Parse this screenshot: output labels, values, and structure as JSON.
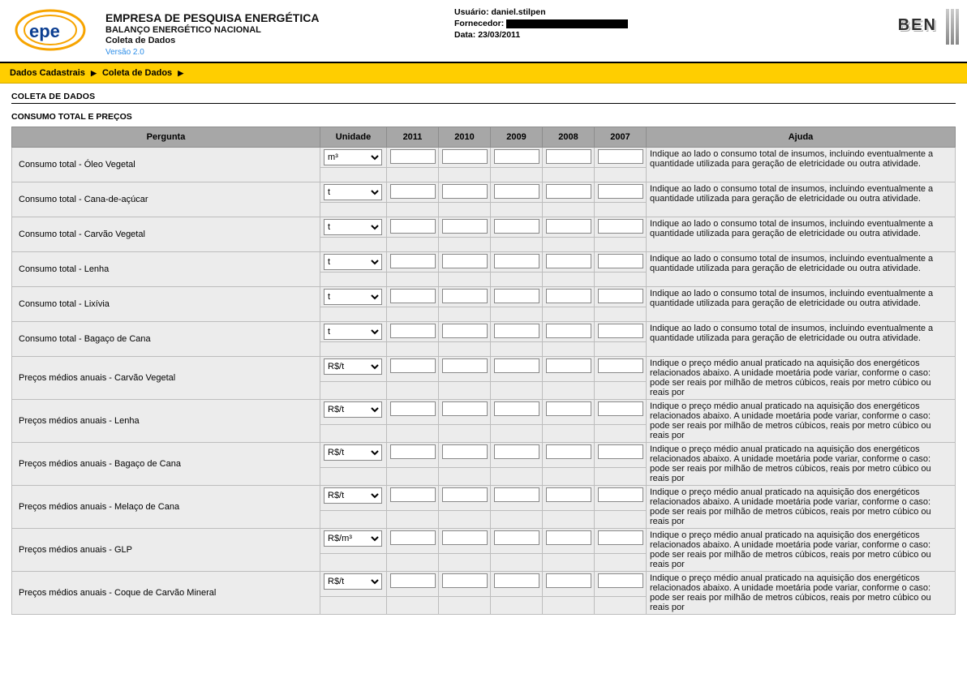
{
  "header": {
    "org_name": "EMPRESA DE PESQUISA ENERGÉTICA",
    "subtitle1": "BALANÇO ENERGÉTICO NACIONAL",
    "subtitle2": "Coleta de Dados",
    "version": "Versão 2.0",
    "user_label": "Usuário:",
    "user_value": "daniel.stilpen",
    "fornecedor_label": "Fornecedor:",
    "data_label": "Data:",
    "data_value": "23/03/2011",
    "ben_text": "BEN"
  },
  "breadcrumb": {
    "item1": "Dados Cadastrais",
    "item2": "Coleta de Dados"
  },
  "section_title": "COLETA DE DADOS",
  "subsection_title": "CONSUMO TOTAL E PREÇOS",
  "table": {
    "headers": {
      "pergunta": "Pergunta",
      "unidade": "Unidade",
      "y2011": "2011",
      "y2010": "2010",
      "y2009": "2009",
      "y2008": "2008",
      "y2007": "2007",
      "ajuda": "Ajuda"
    },
    "help_consumo": "Indique ao lado o consumo total de insumos, incluindo eventualmente a quantidade utilizada para geração de eletricidade ou outra atividade.",
    "help_preco": "Indique o preço médio anual praticado na aquisição dos energéticos relacionados abaixo. A unidade moetária pode variar, conforme o caso: pode ser reais por milhão de metros cúbicos, reais por metro cúbico ou reais por",
    "rows": [
      {
        "label": "Consumo total - Óleo Vegetal",
        "unit": "m³",
        "help": "consumo"
      },
      {
        "label": "Consumo total - Cana-de-açúcar",
        "unit": "t",
        "help": "consumo"
      },
      {
        "label": "Consumo total - Carvão Vegetal",
        "unit": "t",
        "help": "consumo"
      },
      {
        "label": "Consumo total - Lenha",
        "unit": "t",
        "help": "consumo"
      },
      {
        "label": "Consumo total - Lixívia",
        "unit": "t",
        "help": "consumo"
      },
      {
        "label": "Consumo total - Bagaço de Cana",
        "unit": "t",
        "help": "consumo"
      },
      {
        "label": "Preços médios anuais - Carvão Vegetal",
        "unit": "R$/t",
        "help": "preco"
      },
      {
        "label": "Preços médios anuais - Lenha",
        "unit": "R$/t",
        "help": "preco"
      },
      {
        "label": "Preços médios anuais - Bagaço de Cana",
        "unit": "R$/t",
        "help": "preco"
      },
      {
        "label": "Preços médios anuais - Melaço de Cana",
        "unit": "R$/t",
        "help": "preco"
      },
      {
        "label": "Preços médios anuais - GLP",
        "unit": "R$/m³",
        "help": "preco"
      },
      {
        "label": "Preços médios anuais - Coque de Carvão Mineral",
        "unit": "R$/t",
        "help": "preco"
      }
    ],
    "unit_options": [
      "m³",
      "t",
      "R$/t",
      "R$/m³"
    ]
  }
}
